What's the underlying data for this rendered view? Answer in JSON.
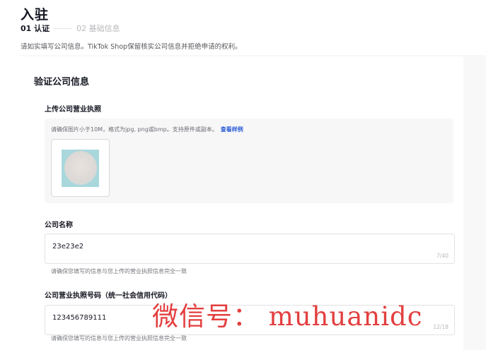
{
  "page": {
    "title": "入驻",
    "subtitle": "请如实填写公司信息。TikTok Shop保留核实公司信息并拒绝申请的权利。"
  },
  "steps": [
    {
      "label": "01 认证",
      "active": true
    },
    {
      "label": "02 基础信息",
      "active": false
    }
  ],
  "section": {
    "title": "验证公司信息"
  },
  "upload": {
    "label": "上传公司营业执照",
    "hint": "请确保图片小于10M，格式为jpg, png或bmp。支持原件或副本。",
    "sample_link": "查看样例"
  },
  "company_name": {
    "label": "公司名称",
    "value": "23e23e2",
    "count": "7/40",
    "hint": "请确保您填写的信息与您上传的营业执照信息完全一致"
  },
  "license_number": {
    "label": "公司营业执照号码（统一社会信用代码）",
    "value": "123456789111",
    "count": "12/18",
    "hint": "请确保您填写的信息与您上传的营业执照信息完全一致"
  },
  "watermark": "微信号： muhuanidc",
  "colors": {
    "link": "#2a5bd7",
    "watermark": "#e02b2b",
    "text_primary": "#161823"
  }
}
